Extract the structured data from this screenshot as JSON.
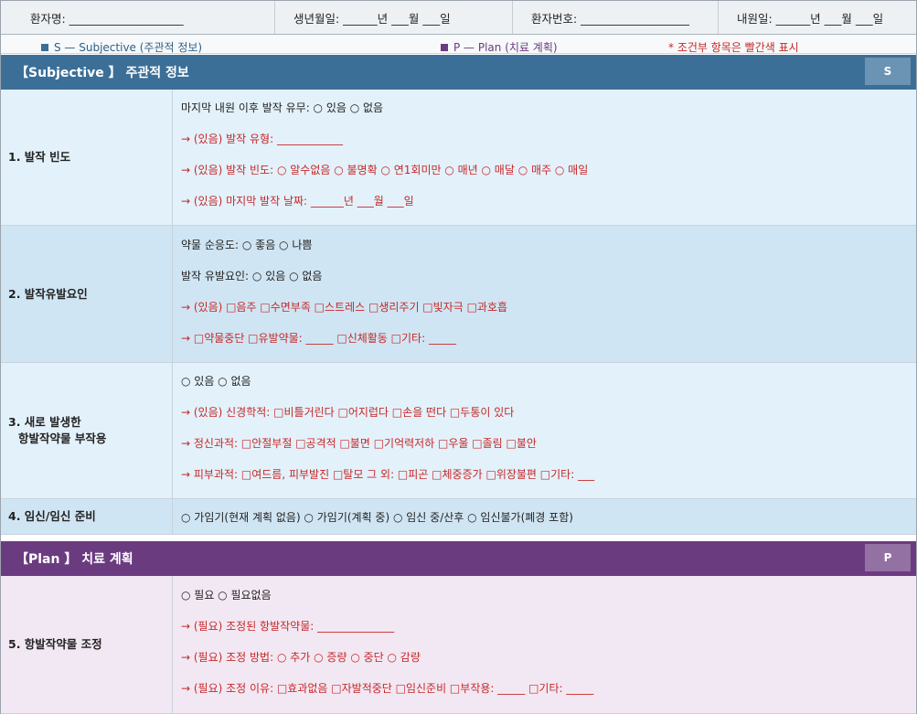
{
  "header": {
    "patient_name": "환자명: ____________________",
    "birth_date": "생년월일: ______년 ___월 ___일",
    "patient_no": "환자번호: ___________________",
    "visit_date": "내원일: ______년 ___월 ___일"
  },
  "legend": {
    "subjective": "S — Subjective (주관적 정보)",
    "plan": "P — Plan (치료 계획)",
    "note": "* 조건부 항목은 빨간색 표시"
  },
  "colors": {
    "subjective": "#3b6f97",
    "plan": "#6b3b80",
    "conditional": "#c62828"
  },
  "subjective": {
    "title": "【Subjective 】  주관적 정보",
    "badge": "S",
    "rows": [
      {
        "label": "1. 발작 빈도",
        "lines": [
          "마지막 내원 이후 발작 유무: ○ 있음  ○ 없음",
          "→ (있음) 발작 유형: ____________",
          "→ (있음) 발작 빈도: ○ 알수없음 ○ 불명확 ○ 연1회미만 ○ 매년 ○ 매달 ○ 매주 ○ 매일",
          "→ (있음) 마지막 발작 날짜: ______년 ___월 ___일"
        ]
      },
      {
        "label": "2. 발작유발요인",
        "lines": [
          "약물 순응도: ○ 좋음  ○ 나쁨",
          "발작 유발요인: ○ 있음  ○ 없음",
          "→ (있음) □음주 □수면부족 □스트레스 □생리주기 □빛자극 □과호흡",
          "→          □약물중단 □유발약물: _____  □신체활동 □기타: _____"
        ]
      },
      {
        "label_line1": "3. 새로 발생한",
        "label_line2": "항발작약물 부작용",
        "lines": [
          "○ 있음  ○ 없음",
          "→ (있음) 신경학적: □비틀거린다 □어지럽다 □손을 떤다 □두통이 있다",
          "→          정신과적: □안절부절 □공격적 □불면 □기억력저하 □우울 □졸림 □불안",
          "→          피부과적: □여드름, 피부발진 □탈모   그 외: □피곤 □체중증가 □위장불편 □기타: ___"
        ]
      },
      {
        "label": "4. 임신/임신 준비",
        "lines": [
          "○ 가임기(현재 계획 없음)  ○ 가임기(계획 중)  ○ 임신 중/산후  ○ 임신불가(폐경 포함)"
        ]
      }
    ]
  },
  "plan": {
    "title": "【Plan 】  치료 계획",
    "badge": "P",
    "rows": [
      {
        "label": "5. 항발작약물 조정",
        "lines": [
          "○ 필요  ○ 필요없음",
          "→ (필요) 조정된 항발작약물: ______________",
          "→ (필요) 조정 방법: ○ 추가  ○ 증량  ○ 중단  ○ 감량",
          "→ (필요) 조정 이유: □효과없음 □자발적중단 □임신준비 □부작용: _____  □기타: _____"
        ]
      }
    ]
  }
}
